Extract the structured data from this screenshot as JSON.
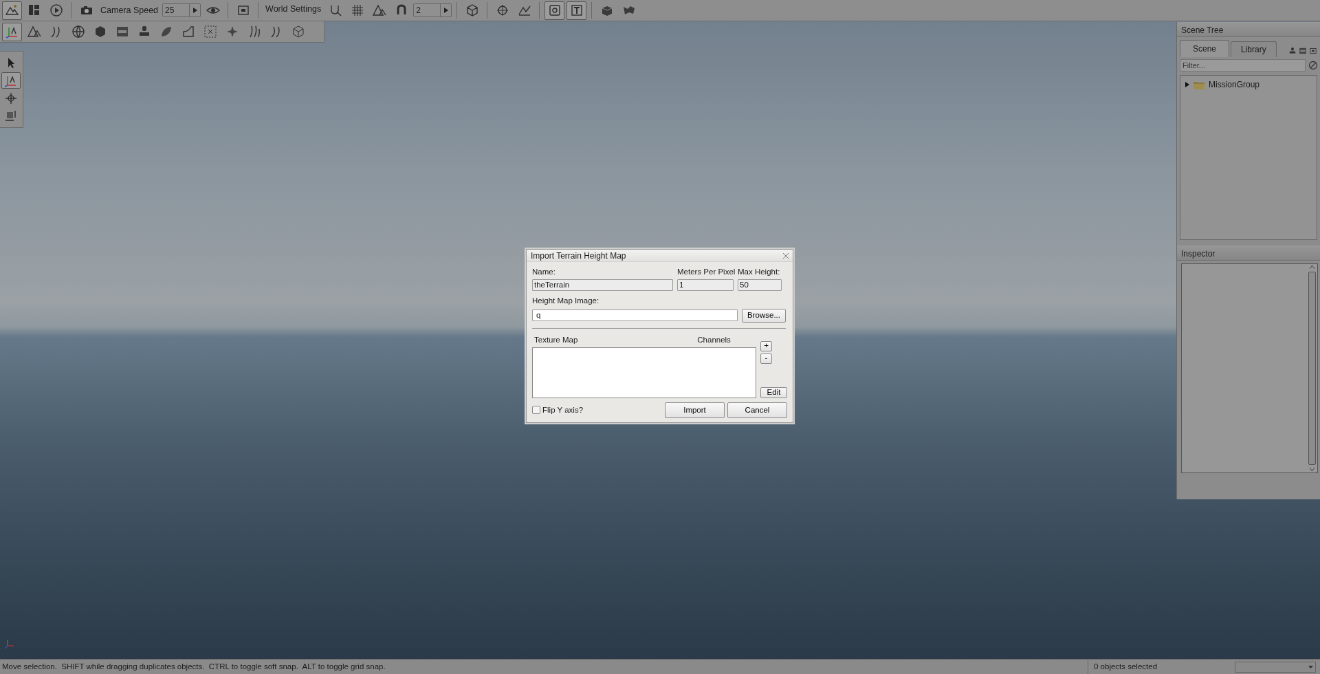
{
  "main_toolbar": [
    {
      "kind": "icon",
      "selected": true
    },
    {
      "kind": "icon",
      "selected": false
    },
    {
      "kind": "icon",
      "selected": false
    },
    {
      "kind": "separator"
    },
    {
      "kind": "icon",
      "selected": false
    },
    {
      "kind": "label",
      "text": "Camera Speed"
    },
    {
      "kind": "spin",
      "value": "25"
    },
    {
      "kind": "icon",
      "selected": false
    },
    {
      "kind": "separator"
    },
    {
      "kind": "icon",
      "selected": false
    },
    {
      "kind": "separator"
    },
    {
      "kind": "label",
      "text": "World Settings"
    },
    {
      "kind": "icon",
      "selected": false
    },
    {
      "kind": "icon",
      "selected": false
    },
    {
      "kind": "icon",
      "selected": false
    },
    {
      "kind": "icon",
      "selected": false
    },
    {
      "kind": "spin",
      "value": "2"
    },
    {
      "kind": "separator"
    },
    {
      "kind": "icon",
      "selected": false
    },
    {
      "kind": "separator"
    },
    {
      "kind": "icon",
      "selected": false
    },
    {
      "kind": "icon",
      "selected": false
    },
    {
      "kind": "separator"
    },
    {
      "kind": "icon",
      "selected": true
    },
    {
      "kind": "icon",
      "selected": true
    },
    {
      "kind": "separator"
    },
    {
      "kind": "icon",
      "selected": false
    },
    {
      "kind": "icon",
      "selected": false
    }
  ],
  "tool_toolbar": [
    {
      "selected": true
    },
    {
      "selected": false
    },
    {
      "selected": false
    },
    {
      "selected": false
    },
    {
      "selected": false
    },
    {
      "selected": false
    },
    {
      "selected": false
    },
    {
      "selected": false
    },
    {
      "selected": false
    },
    {
      "selected": false
    },
    {
      "selected": false
    },
    {
      "selected": false
    },
    {
      "selected": false
    },
    {
      "selected": false
    }
  ],
  "tool_palette": [
    {
      "selected": false
    },
    {
      "selected": true
    },
    {
      "selected": false
    },
    {
      "selected": false
    }
  ],
  "dialog": {
    "title": "Import Terrain Height Map",
    "name": {
      "label": "Name:",
      "value": "theTerrain"
    },
    "meters_per_pixel": {
      "label": "Meters Per Pixel",
      "value": "1"
    },
    "max_height": {
      "label": "Max Height:",
      "value": "50"
    },
    "height_map": {
      "label": "Height Map Image:",
      "value": "q"
    },
    "browse": "Browse...",
    "texture_columns": [
      "Texture Map",
      "Channels"
    ],
    "add": "+",
    "remove": "-",
    "edit": "Edit",
    "flip_y": {
      "label": "Flip Y axis?",
      "checked": false
    },
    "buttons": [
      "Import",
      "Cancel"
    ]
  },
  "scene_tree": {
    "title": "Scene Tree",
    "tabs": [
      {
        "label": "Scene",
        "selected": true
      },
      {
        "label": "Library",
        "selected": false
      }
    ],
    "filter": {
      "placeholder": "Filter..."
    },
    "items": [
      {
        "label": "MissionGroup",
        "expanded": false
      }
    ]
  },
  "inspector": {
    "title": "Inspector"
  },
  "status_bar": {
    "message": "Move selection.  SHIFT while dragging duplicates objects.  CTRL to toggle soft snap.  ALT to toggle grid snap.",
    "selection": "0 objects selected"
  }
}
